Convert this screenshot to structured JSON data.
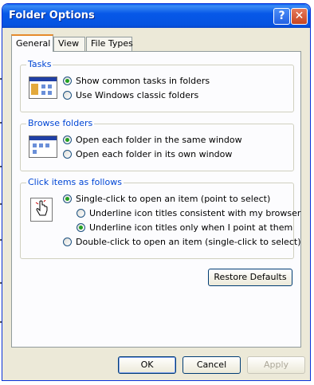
{
  "window": {
    "title": "Folder Options"
  },
  "tabs": [
    {
      "label": "General"
    },
    {
      "label": "View"
    },
    {
      "label": "File Types"
    }
  ],
  "tasks": {
    "label": "Tasks",
    "options": [
      {
        "label": "Show common tasks in folders",
        "selected": true
      },
      {
        "label": "Use Windows classic folders",
        "selected": false
      }
    ]
  },
  "browse": {
    "label": "Browse folders",
    "options": [
      {
        "label": "Open each folder in the same window",
        "selected": true
      },
      {
        "label": "Open each folder in its own window",
        "selected": false
      }
    ]
  },
  "click": {
    "label": "Click items as follows",
    "options": [
      {
        "label": "Single-click to open an item (point to select)",
        "selected": true
      },
      {
        "label": "Underline icon titles consistent with my browser",
        "selected": false
      },
      {
        "label": "Underline icon titles only when I point at them",
        "selected": true
      },
      {
        "label": "Double-click to open an item (single-click to select)",
        "selected": false
      }
    ]
  },
  "buttons": {
    "restore": "Restore Defaults",
    "ok": "OK",
    "cancel": "Cancel",
    "apply": "Apply"
  }
}
